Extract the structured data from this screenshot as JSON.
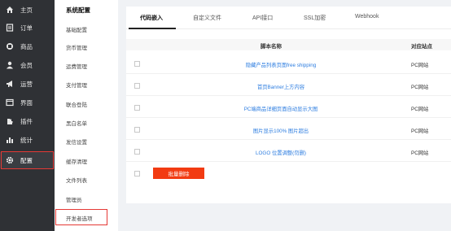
{
  "nav": {
    "items": [
      {
        "label": "主页",
        "icon": "home-icon"
      },
      {
        "label": "订单",
        "icon": "order-icon"
      },
      {
        "label": "商品",
        "icon": "goods-icon"
      },
      {
        "label": "会员",
        "icon": "member-icon"
      },
      {
        "label": "运营",
        "icon": "megaphone-icon"
      },
      {
        "label": "界面",
        "icon": "layout-icon"
      },
      {
        "label": "插件",
        "icon": "plugin-icon"
      },
      {
        "label": "统计",
        "icon": "chart-icon"
      },
      {
        "label": "配置",
        "icon": "gear-icon"
      }
    ]
  },
  "subnav": {
    "title": "系统配置",
    "items": [
      "基础配置",
      "货币管理",
      "运费管理",
      "支付管理",
      "联合登陆",
      "黑白名单",
      "发信设置",
      "缓存清理",
      "文件列表",
      "管理员",
      "开发者选项"
    ]
  },
  "tabs": [
    "代码嵌入",
    "自定义文件",
    "API接口",
    "SSL加密",
    "Webhook"
  ],
  "table": {
    "headers": {
      "name": "脚本名称",
      "site": "对应站点"
    },
    "rows": [
      {
        "name": "隐藏产品列表页面free shipping",
        "site": "PC网站"
      },
      {
        "name": "首页Banner上方内容",
        "site": "PC网站"
      },
      {
        "name": "PC端商品详细页面自动显示大图",
        "site": "PC网站"
      },
      {
        "name": "图片显示100% 图片超出",
        "site": "PC网站"
      },
      {
        "name": "LOGO 位置调整(勿删)",
        "site": "PC网站"
      }
    ]
  },
  "actions": {
    "batch_delete": "批量删除"
  },
  "colors": {
    "nav_bg": "#2f3135",
    "accent_red": "#e53935",
    "delete_button": "#f23b12",
    "link_blue": "#2d7de0"
  }
}
